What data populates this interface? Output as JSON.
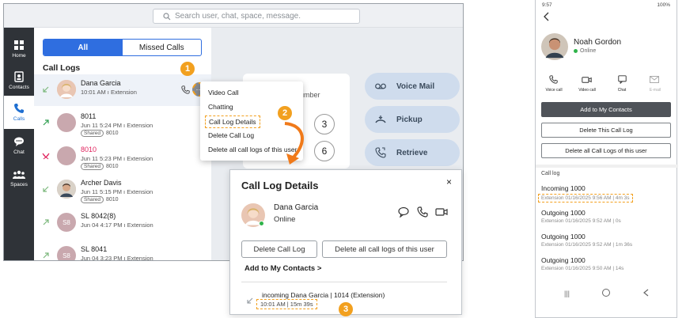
{
  "desktop": {
    "search_placeholder": "Search user, chat, space, message.",
    "nav": [
      {
        "label": "Home"
      },
      {
        "label": "Contacts"
      },
      {
        "label": "Calls"
      },
      {
        "label": "Chat"
      },
      {
        "label": "Spaces"
      }
    ],
    "tabs": {
      "all": "All",
      "missed": "Missed Calls"
    },
    "call_logs_title": "Call Logs",
    "rows": [
      {
        "name": "Dana Garcia",
        "line1": "10:01 AM  ı  Extension",
        "line2": "",
        "avatar": "",
        "name_color": "#222222"
      },
      {
        "name": "8011",
        "line1": "Jun 11 5:24 PM  ı  Extension",
        "shared": "Shared",
        "line2": "8010",
        "avatar": "",
        "name_color": "#222222"
      },
      {
        "name": "8010",
        "line1": "Jun 11 5:23 PM  ı  Extension",
        "shared": "Shared",
        "line2": "8010",
        "avatar": "",
        "name_color": "#e0245e"
      },
      {
        "name": "Archer Davis",
        "line1": "Jun 11 5:15 PM  ı  Extension",
        "shared": "Shared",
        "line2": "8010",
        "avatar": "",
        "name_color": "#222222"
      },
      {
        "name": "SL 8042(8)",
        "line1": "Jun 04 4:17 PM  ı  Extension",
        "line2": "",
        "avatar": "S8",
        "name_color": "#222222"
      },
      {
        "name": "SL 8041",
        "line1": "Jun 04 3:23 PM  ı  Extension",
        "line2": "",
        "avatar": "S8",
        "name_color": "#222222"
      }
    ],
    "context_menu": [
      "Video Call",
      "Chatting",
      "Call Log Details",
      "Delete Call Log",
      "Delete all call logs of this user"
    ],
    "dial_label": "umber",
    "keys": [
      "3",
      "6"
    ],
    "actions": [
      "Voice Mail",
      "Pickup",
      "Retrieve"
    ],
    "badges": [
      "1",
      "2",
      "3"
    ]
  },
  "detail": {
    "title": "Call Log Details",
    "name": "Dana Garcia",
    "status": "Online",
    "delete_btn": "Delete Call Log",
    "delete_all_btn": "Delete all call logs of this user",
    "add_contacts": "Add to My Contacts  >",
    "entry_title": "incoming  Dana Garcia | 1014 (Extension)",
    "entry_sub": "10:01 AM | 15m 39s"
  },
  "phone": {
    "status_time": "9:57",
    "status_right": "100%",
    "name": "Noah Gordon",
    "status": "Online",
    "actions": [
      "Voice call",
      "Video call",
      "Chat",
      "E-mail"
    ],
    "add_contacts": "Add to My Contacts",
    "delete_log": "Delete This Call Log",
    "delete_all": "Delete all Call Logs of this user",
    "call_log_label": "Call log",
    "logs": [
      {
        "title": "Incoming  1000",
        "sub": "Extension 01/16/2025 9:56 AM | 4m 3s"
      },
      {
        "title": "Outgoing  1000",
        "sub": "Extension 01/16/2025 9:52 AM | 0s"
      },
      {
        "title": "Outgoing  1000",
        "sub": "Extension 01/16/2025 9:52 AM | 1m 36s"
      },
      {
        "title": "Outgoing  1000",
        "sub": "Extension 01/16/2025 9:50 AM | 14s"
      }
    ]
  },
  "colors": {
    "accent": "#2f6ee0",
    "highlight": "#f2a01f",
    "missed": "#e0245e"
  }
}
